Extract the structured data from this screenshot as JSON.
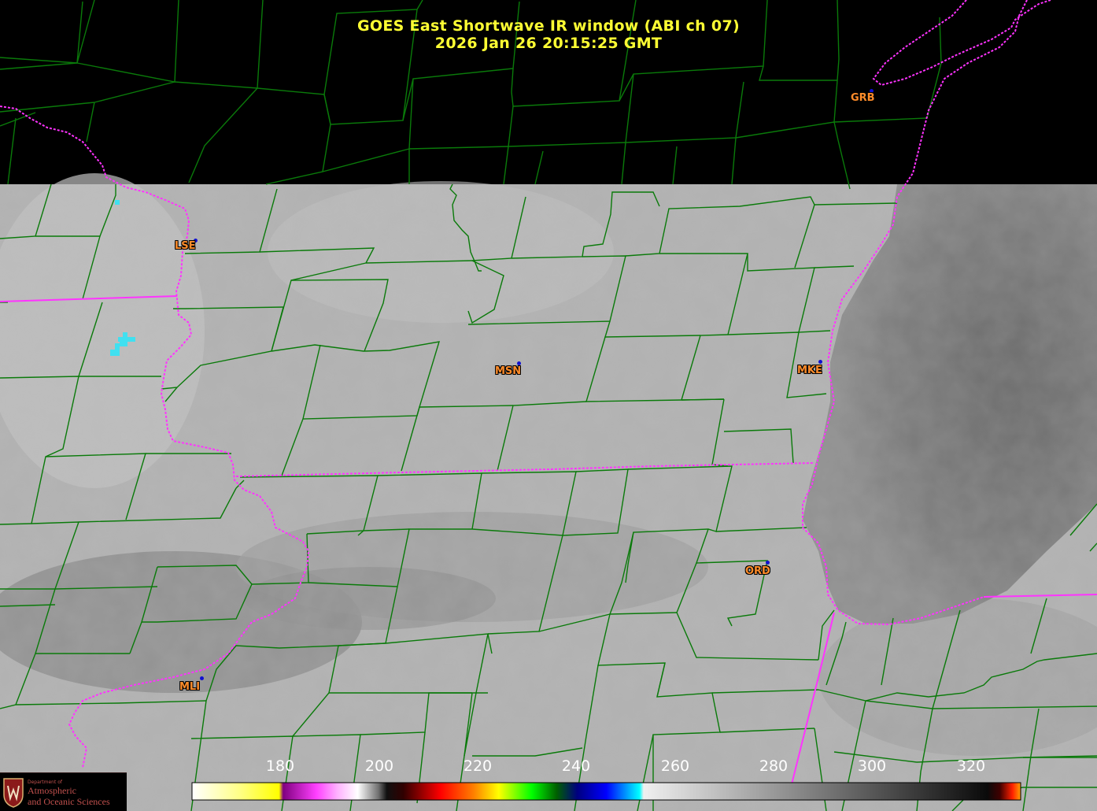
{
  "title": {
    "line1": "GOES East Shortwave IR window (ABI ch 07)",
    "line2": "2026 Jan 26  20:15:25 GMT"
  },
  "stations": [
    {
      "code": "GRB"
    },
    {
      "code": "LSE"
    },
    {
      "code": "MSN"
    },
    {
      "code": "MKE"
    },
    {
      "code": "ORD"
    },
    {
      "code": "MLI"
    }
  ],
  "colorbar": {
    "ticks": [
      "180",
      "200",
      "220",
      "240",
      "260",
      "280",
      "300",
      "320"
    ],
    "range": [
      163,
      330
    ]
  },
  "logo": {
    "line1": "Department of",
    "line2": "Atmospheric",
    "line3": "and Oceanic Sciences"
  },
  "colors": {
    "title": "#ffff33",
    "county_lines": "#0a7a0a",
    "state_borders": "#ff33ff",
    "station_label": "#ff8c2a",
    "station_dot": "#1010d0",
    "cold_cloud": "#40e0f0"
  }
}
